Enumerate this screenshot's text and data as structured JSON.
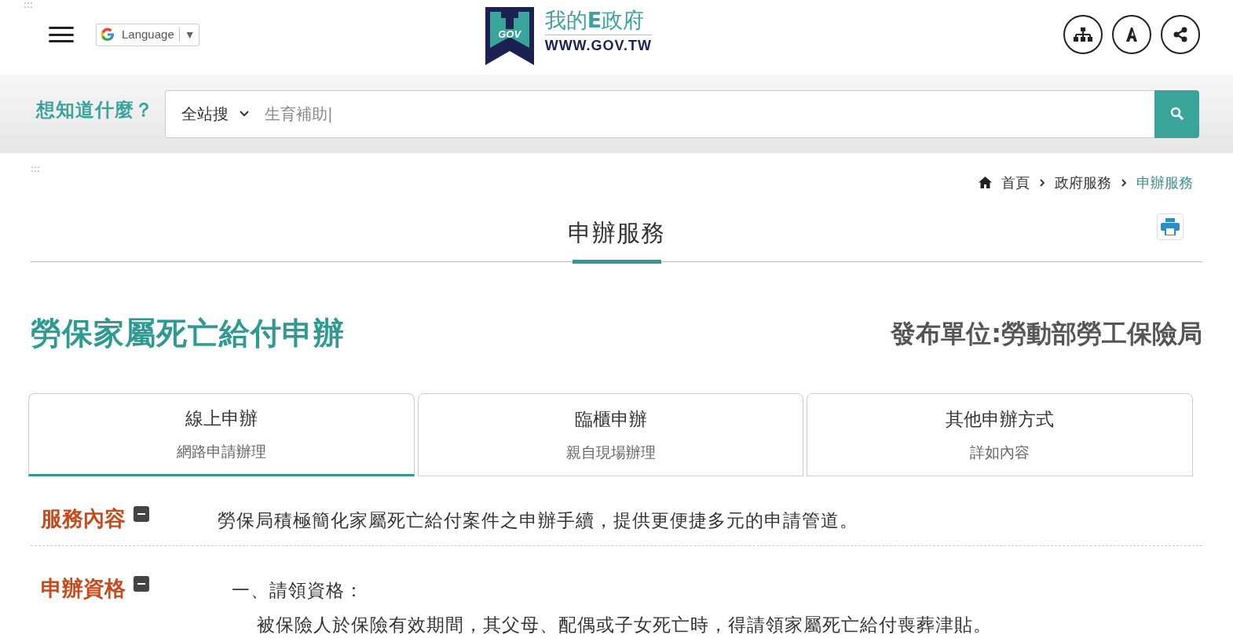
{
  "accesskey_top": ":::",
  "language": {
    "label": "Language",
    "caret": "▼"
  },
  "logo": {
    "badge": "GOV",
    "title_pre": "我的",
    "title_e": "E",
    "title_post": "政府",
    "url": "WWW.GOV.TW"
  },
  "search": {
    "prompt": "想知道什麼？",
    "scope": "全站搜",
    "value": "生育補助|"
  },
  "accesskey_main": ":::",
  "breadcrumb": [
    {
      "label": "首頁",
      "selected": false
    },
    {
      "label": "政府服務",
      "selected": false
    },
    {
      "label": "申辦服務",
      "selected": true
    }
  ],
  "page_title": "申辦服務",
  "heading": "勞保家屬死亡給付申辦",
  "publisher": "發布單位:勞動部勞工保險局",
  "tabs": [
    {
      "label": "線上申辦",
      "sub": "網路申請辦理",
      "selected": true
    },
    {
      "label": "臨櫃申辦",
      "sub": "親自現場辦理",
      "selected": false
    },
    {
      "label": "其他申辦方式",
      "sub": "詳如內容",
      "selected": false
    }
  ],
  "sections": [
    {
      "title": "服務內容",
      "expanded": true,
      "lines": [
        {
          "kind": "text",
          "text": "勞保局積極簡化家屬死亡給付案件之申辦手續，提供更便捷多元的申請管道。"
        }
      ]
    },
    {
      "title": "申辦資格",
      "expanded": true,
      "lines": [
        {
          "kind": "heading",
          "text": "一、請領資格："
        },
        {
          "kind": "indent",
          "text": "被保險人於保險有效期間，其父母、配偶或子女死亡時，得請領家屬死亡給付喪葬津貼。"
        }
      ]
    }
  ]
}
